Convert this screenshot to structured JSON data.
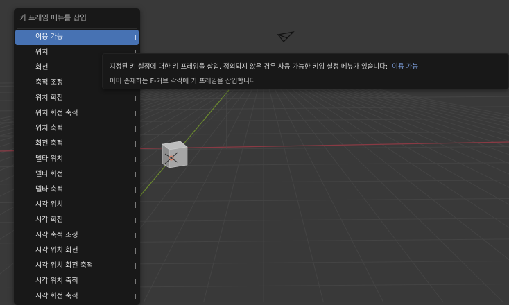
{
  "menu": {
    "title": "키 프레임 메뉴를 삽입",
    "items": [
      {
        "label": "이용 가능",
        "active": true
      },
      {
        "label": "위치"
      },
      {
        "label": "회전"
      },
      {
        "label": "축적 조정"
      },
      {
        "label": "위치 회전"
      },
      {
        "label": "위치 회전 축적"
      },
      {
        "label": "위치 축적"
      },
      {
        "label": "회전 축적"
      },
      {
        "label": "델타 위치"
      },
      {
        "label": "델타 회전"
      },
      {
        "label": "델타 축적"
      },
      {
        "label": "시각 위치"
      },
      {
        "label": "시각 회전"
      },
      {
        "label": "시각 축적 조정"
      },
      {
        "label": "시각 위치 회전"
      },
      {
        "label": "시각 위치 회전 축적"
      },
      {
        "label": "시각 위치 축적"
      },
      {
        "label": "시각 회전 축적"
      }
    ]
  },
  "tooltip": {
    "description": "지정된 키 설정에 대한 키 프레임을 삽입. 정의되지 않은 경우 사용 가능한 키잉 설정 메뉴가 있습니다:",
    "value": "이용 가능",
    "detail": "이미 존재하는 F-커브 각각에 키 프레임을 삽입합니다"
  },
  "colors": {
    "viewport_bg": "#393939",
    "grid_line": "#444444",
    "x_axis": "#8a3a44",
    "y_axis": "#6b8a2e",
    "menu_bg": "#181818",
    "highlight": "#4772b3"
  }
}
